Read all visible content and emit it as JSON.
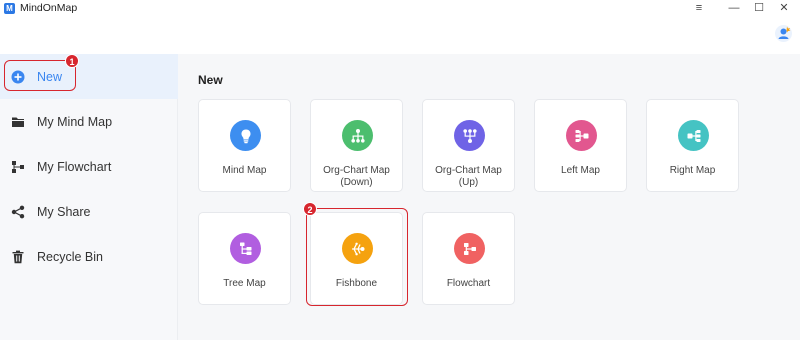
{
  "app": {
    "title": "MindOnMap",
    "logo_letter": "M"
  },
  "window_controls": {
    "menu": "≡",
    "minimize": "—",
    "maximize": "☐",
    "close": "✕"
  },
  "sidebar": {
    "items": [
      {
        "label": "New",
        "icon": "plus-circle-icon"
      },
      {
        "label": "My Mind Map",
        "icon": "folder-icon"
      },
      {
        "label": "My Flowchart",
        "icon": "flowchart-icon"
      },
      {
        "label": "My Share",
        "icon": "share-icon"
      },
      {
        "label": "Recycle Bin",
        "icon": "trash-icon"
      }
    ],
    "active": "New"
  },
  "main": {
    "section_title": "New",
    "templates": [
      {
        "label": "Mind Map",
        "icon": "lightbulb-icon",
        "color": "#3d8ef0"
      },
      {
        "label": "Org-Chart Map (Down)",
        "icon": "org-chart-down-icon",
        "color": "#4cbe6e"
      },
      {
        "label": "Org-Chart Map (Up)",
        "icon": "org-chart-up-icon",
        "color": "#6f63e6"
      },
      {
        "label": "Left Map",
        "icon": "left-map-icon",
        "color": "#e2578f"
      },
      {
        "label": "Right Map",
        "icon": "right-map-icon",
        "color": "#45c3c3"
      },
      {
        "label": "Tree Map",
        "icon": "tree-map-icon",
        "color": "#b15ee0"
      },
      {
        "label": "Fishbone",
        "icon": "fishbone-icon",
        "color": "#f5a20f"
      },
      {
        "label": "Flowchart",
        "icon": "flowchart-template-icon",
        "color": "#f06262"
      }
    ]
  },
  "annotations": {
    "badge_1": "1",
    "badge_2": "2",
    "highlight_color": "#d7262e"
  }
}
